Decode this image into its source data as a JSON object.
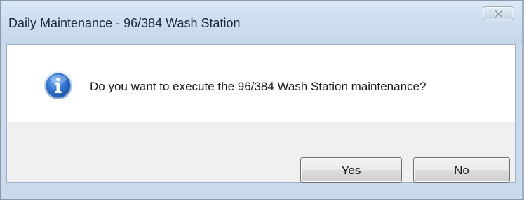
{
  "window": {
    "title": "Daily Maintenance - 96/384 Wash Station",
    "close_icon": "close-icon"
  },
  "message": {
    "icon": "info-icon",
    "text": "Do you want to execute the 96/384 Wash Station maintenance?"
  },
  "buttons": {
    "yes_label": "Yes",
    "no_label": "No"
  },
  "colors": {
    "titlebar": "#cfe0f1",
    "content_bg": "#ffffff",
    "button_area_bg": "#f0f0f0",
    "info_icon_blue": "#2a6fcf"
  }
}
